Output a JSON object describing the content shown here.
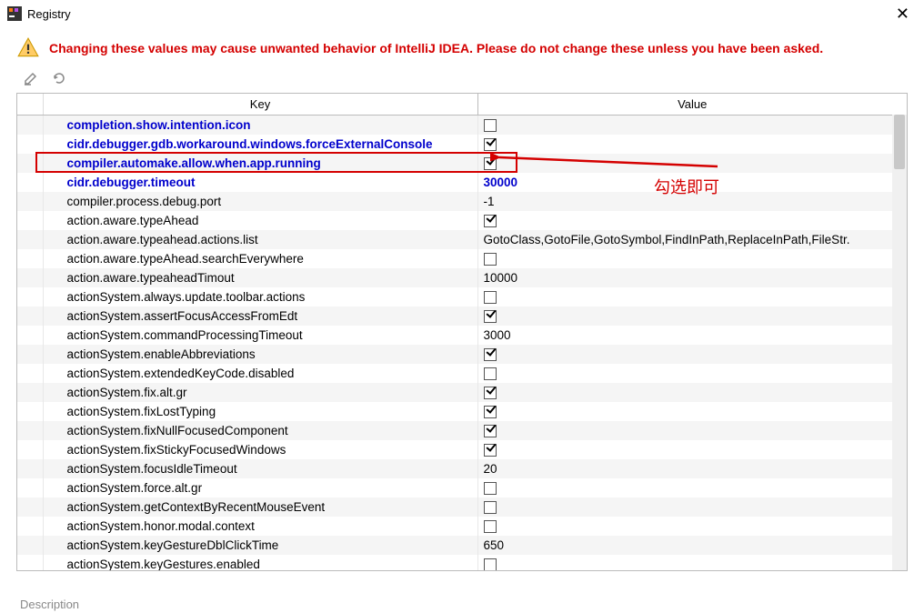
{
  "window": {
    "title": "Registry",
    "close_glyph": "✕"
  },
  "warning": "Changing these values may cause unwanted behavior of IntelliJ IDEA. Please do not change these unless you have been asked.",
  "columns": {
    "key": "Key",
    "value": "Value"
  },
  "annotation": {
    "label": "勾选即可"
  },
  "description_label": "Description",
  "rows": [
    {
      "key": "completion.show.intention.icon",
      "type": "check",
      "checked": false,
      "changed": true
    },
    {
      "key": "cidr.debugger.gdb.workaround.windows.forceExternalConsole",
      "type": "check",
      "checked": true,
      "changed": true
    },
    {
      "key": "compiler.automake.allow.when.app.running",
      "type": "check",
      "checked": true,
      "changed": true,
      "highlight": true
    },
    {
      "key": "cidr.debugger.timeout",
      "type": "text",
      "value": "30000",
      "changed": true
    },
    {
      "key": "compiler.process.debug.port",
      "type": "text",
      "value": "-1",
      "changed": false
    },
    {
      "key": "action.aware.typeAhead",
      "type": "check",
      "checked": true,
      "changed": false
    },
    {
      "key": "action.aware.typeahead.actions.list",
      "type": "text",
      "value": "GotoClass,GotoFile,GotoSymbol,FindInPath,ReplaceInPath,FileStr.",
      "changed": false
    },
    {
      "key": "action.aware.typeAhead.searchEverywhere",
      "type": "check",
      "checked": false,
      "changed": false
    },
    {
      "key": "action.aware.typeaheadTimout",
      "type": "text",
      "value": "10000",
      "changed": false
    },
    {
      "key": "actionSystem.always.update.toolbar.actions",
      "type": "check",
      "checked": false,
      "changed": false
    },
    {
      "key": "actionSystem.assertFocusAccessFromEdt",
      "type": "check",
      "checked": true,
      "changed": false
    },
    {
      "key": "actionSystem.commandProcessingTimeout",
      "type": "text",
      "value": "3000",
      "changed": false
    },
    {
      "key": "actionSystem.enableAbbreviations",
      "type": "check",
      "checked": true,
      "changed": false
    },
    {
      "key": "actionSystem.extendedKeyCode.disabled",
      "type": "check",
      "checked": false,
      "changed": false
    },
    {
      "key": "actionSystem.fix.alt.gr",
      "type": "check",
      "checked": true,
      "changed": false
    },
    {
      "key": "actionSystem.fixLostTyping",
      "type": "check",
      "checked": true,
      "changed": false
    },
    {
      "key": "actionSystem.fixNullFocusedComponent",
      "type": "check",
      "checked": true,
      "changed": false
    },
    {
      "key": "actionSystem.fixStickyFocusedWindows",
      "type": "check",
      "checked": true,
      "changed": false
    },
    {
      "key": "actionSystem.focusIdleTimeout",
      "type": "text",
      "value": "20",
      "changed": false
    },
    {
      "key": "actionSystem.force.alt.gr",
      "type": "check",
      "checked": false,
      "changed": false
    },
    {
      "key": "actionSystem.getContextByRecentMouseEvent",
      "type": "check",
      "checked": false,
      "changed": false
    },
    {
      "key": "actionSystem.honor.modal.context",
      "type": "check",
      "checked": false,
      "changed": false
    },
    {
      "key": "actionSystem.keyGestureDblClickTime",
      "type": "text",
      "value": "650",
      "changed": false
    },
    {
      "key": "actionSystem.keyGestures.enabled",
      "type": "check",
      "checked": false,
      "changed": false
    }
  ]
}
